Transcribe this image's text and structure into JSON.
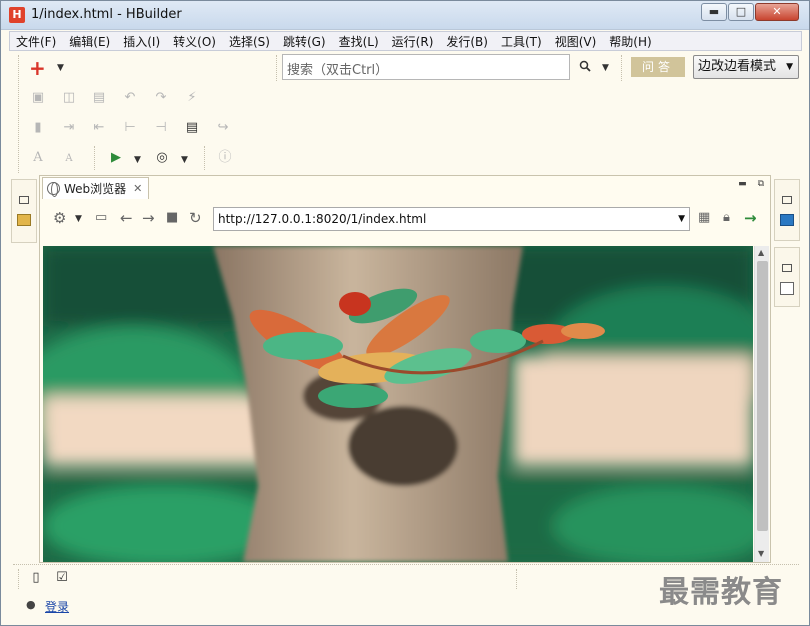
{
  "window": {
    "title": "1/index.html  -  HBuilder",
    "app_icon_letter": "H",
    "controls": {
      "minimize": "▬",
      "maximize": "□",
      "close": "✕"
    }
  },
  "menu": [
    "文件(F)",
    "编辑(E)",
    "插入(I)",
    "转义(O)",
    "选择(S)",
    "跳转(G)",
    "查找(L)",
    "运行(R)",
    "发行(B)",
    "工具(T)",
    "视图(V)",
    "帮助(H)"
  ],
  "toolbar": {
    "search_placeholder": "搜索（双击Ctrl）",
    "qa_button": "问答",
    "mode_select_value": "边改边看模式"
  },
  "browser_pane": {
    "tab_label": "Web浏览器",
    "url": "http://127.0.0.1:8020/1/index.html",
    "content_image": "photo of red-leafed plant sprouting from a tree trunk against green foliage"
  },
  "status": {
    "login_label": "登录",
    "watermark": "最需教育"
  },
  "colors": {
    "accent": "#d9352a",
    "qa_button_bg": "#d1c49a",
    "window_bg": "#fdfaef",
    "link": "#1a46a8"
  }
}
